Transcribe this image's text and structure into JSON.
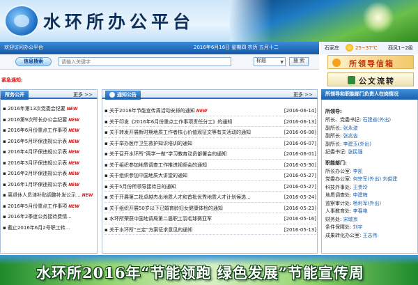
{
  "header": {
    "title": "水环所办公平台"
  },
  "topbar": {
    "welcome": "欢迎访问办公平台",
    "date": "2016年6月16日  星期四  农历  五月十二"
  },
  "search": {
    "badge": "信息搜索",
    "placeholder": "请输入关键字",
    "select": "标题",
    "button": "搜 索"
  },
  "urgent": "紧急通知:",
  "weather": {
    "city": "石家庄",
    "temp": "25~37℃",
    "wind": "西风1~2级"
  },
  "guide_banner": "所领导信箱",
  "doc_flow": "公文流转",
  "left_box": {
    "title": "所务公开",
    "more": "更多 >>",
    "items": [
      {
        "text": "▪ 2016年第13次党委会纪要",
        "new": "NEW"
      },
      {
        "text": "▪ 2016第9次所长办公会纪要",
        "new": "NEW"
      },
      {
        "text": "▪ 2016年6月份重点工作事项",
        "new": "NEW"
      },
      {
        "text": "▪ 2016年5月环保违规公示表",
        "new": "NEW"
      },
      {
        "text": "▪ 2016年4月环保违规公示表",
        "new": "NEW"
      },
      {
        "text": "▪ 2016年3月环保违规公示表",
        "new": "NEW"
      },
      {
        "text": "▪ 2016年2月环保违规公示表",
        "new": "NEW"
      },
      {
        "text": "▪ 2016年1月环保违规公示表",
        "new": "NEW"
      },
      {
        "text": "▪ 离退休人员津补贴调整补发公示...",
        "new": "NEW"
      },
      {
        "text": "▪ 2016年5月份重点工作事项",
        "new": "NEW"
      },
      {
        "text": "▪ 2016年2季度公务接待费情...",
        "new": ""
      },
      {
        "text": "▪ 截止2016年6月2号职工转...",
        "new": ""
      }
    ]
  },
  "notices": {
    "title": "通知公告",
    "more": "更多 >>",
    "items": [
      {
        "title": "▪ 关于2016年节能宣传周活动安排的通知",
        "new": "NEW",
        "date": "[2016-06-14]"
      },
      {
        "title": "▪ 关于印发《2016年6月份重点工作事项责任分工》的通知",
        "new": "",
        "date": "[2016-06-13]"
      },
      {
        "title": "▪ 关于转发开展新时期地质工作者核心价值观征文等有关活动的通知",
        "new": "",
        "date": "[2016-06-08]"
      },
      {
        "title": "▪ 关于举办医疗卫生救护知识培训的通知",
        "new": "",
        "date": "[2016-06-07]"
      },
      {
        "title": "▪ 关于召开水环所“两学一做”学习教育动员部署会的通知",
        "new": "",
        "date": "[2016-06-01]"
      },
      {
        "title": "▪ 关于组织参加地质调查工作推进视频会的通知",
        "new": "",
        "date": "[2016-05-30]"
      },
      {
        "title": "▪ 关于组织参加中国地质大讲堂的通知",
        "new": "",
        "date": "[2016-05-27]"
      },
      {
        "title": "▪ 关于5月份所领导接待日的通知",
        "new": "",
        "date": "[2016-05-27]"
      },
      {
        "title": "▪ 关于开展第二批卓越杰出地质人才和首批优秀地质人才计划候选...",
        "new": "",
        "date": "[2016-05-24]"
      },
      {
        "title": "▪ 关于组织开展50岁以下已婚育龄妇女健康体检的通知",
        "new": "",
        "date": "[2016-05-23]"
      },
      {
        "title": "▪ 水环所荣获中国地调局第二届职工羽毛球赛亚军",
        "new": "",
        "date": "[2016-05-16]"
      },
      {
        "title": "▪ 关于水环所“三定”方案征求意见的通知",
        "new": "",
        "date": "[2016-05-13]"
      }
    ]
  },
  "leaders": {
    "title": "所领导和职能部门负责人在岗情况",
    "section1": "所领导:",
    "rows1": [
      {
        "role": "所长、党委书记: ",
        "name": "石建省(外出)"
      },
      {
        "role": "副所长: ",
        "name": "张永波"
      },
      {
        "role": "副所长: ",
        "name": "张兆吉"
      },
      {
        "role": "副所长: ",
        "name": "李建玉(外出)"
      },
      {
        "role": "纪委书记: ",
        "name": "张民强"
      }
    ],
    "section2": "职能部门:",
    "rows2": [
      {
        "role": "所长办公室: ",
        "name": "李凯"
      },
      {
        "role": "党委办公室: ",
        "name": "何宗军(外出) 刘俊建"
      },
      {
        "role": "科技外事处: ",
        "name": "王贵玲"
      },
      {
        "role": "地质调查处: ",
        "name": "申建梅"
      },
      {
        "role": "监察审计处: ",
        "name": "杨利军(外出)"
      },
      {
        "role": "人事教育处: ",
        "name": "李春艳"
      },
      {
        "role": "财务处: ",
        "name": "宋瑞京"
      },
      {
        "role": "条件保障处: ",
        "name": "刘宇"
      },
      {
        "role": "成果转化办公室: ",
        "name": "王志伟"
      }
    ]
  },
  "bottom_banner": "水环所2016年“节能领跑 绿色发展”节能宣传周"
}
